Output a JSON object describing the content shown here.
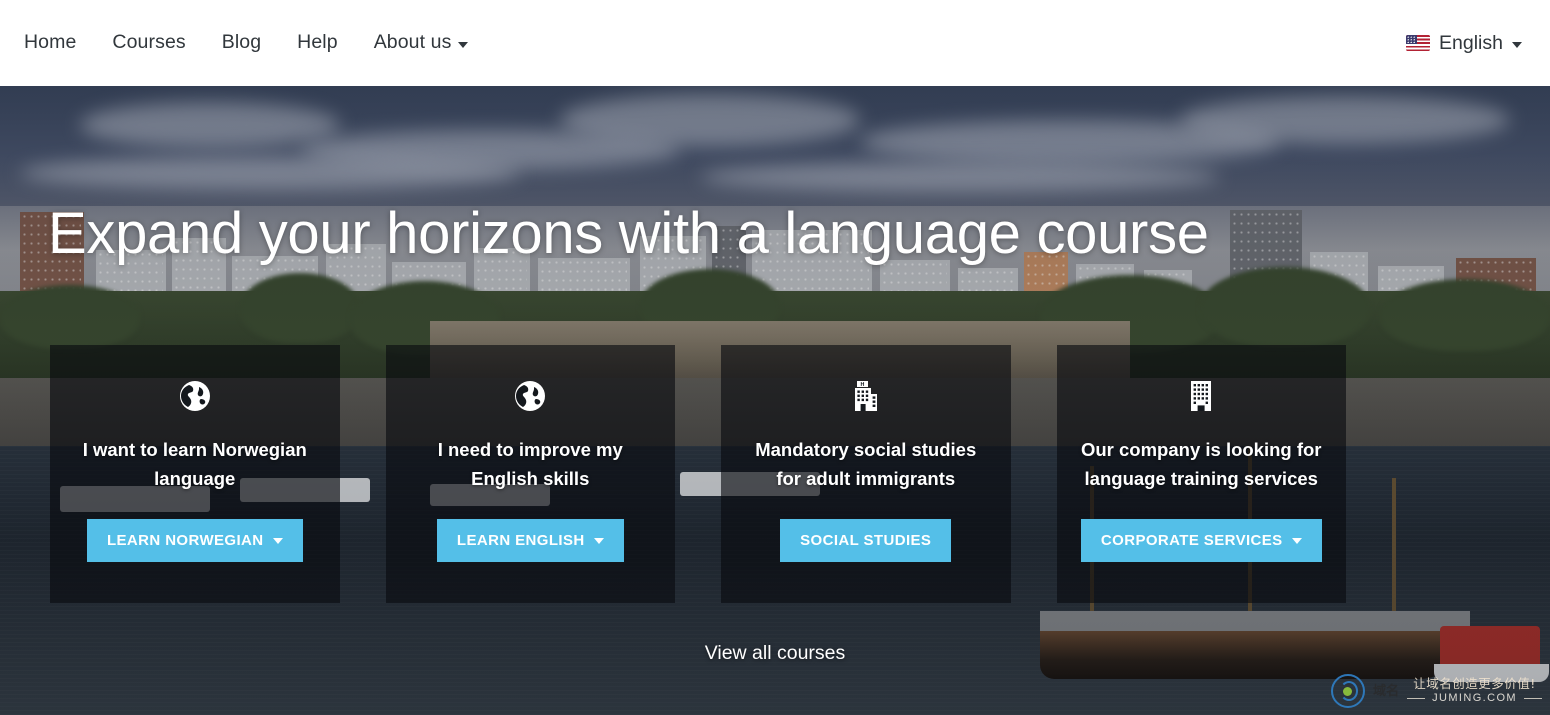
{
  "navbar": {
    "items": [
      {
        "label": "Home",
        "has_caret": false
      },
      {
        "label": "Courses",
        "has_caret": false
      },
      {
        "label": "Blog",
        "has_caret": false
      },
      {
        "label": "Help",
        "has_caret": false
      },
      {
        "label": "About us",
        "has_caret": true
      }
    ],
    "language": {
      "flag_icon": "us-flag-icon",
      "label": "English",
      "has_caret": true
    }
  },
  "hero": {
    "title": "Expand your horizons with a language course",
    "view_all_label": "View all courses",
    "accent_color": "#54bfe8",
    "overlay_color": "rgba(8,10,14,.62)",
    "cards": [
      {
        "icon": "globe-icon",
        "title": "I want to learn Norwegian language",
        "button_label": "LEARN NORWEGIAN",
        "has_caret": true
      },
      {
        "icon": "globe-icon",
        "title": "I need to improve my English skills",
        "button_label": "LEARN ENGLISH",
        "has_caret": true
      },
      {
        "icon": "institution-building-icon",
        "title": "Mandatory social studies for adult immigrants",
        "button_label": "SOCIAL STUDIES",
        "has_caret": false
      },
      {
        "icon": "office-building-icon",
        "title": "Our company is looking for language training services",
        "button_label": "CORPORATE SERVICES",
        "has_caret": true
      }
    ]
  },
  "watermark": {
    "logo_icon": "juming-logo-icon",
    "cjk_mark": "域名",
    "slogan": "让域名创造更多价值!",
    "domain": "JUMING.COM"
  }
}
